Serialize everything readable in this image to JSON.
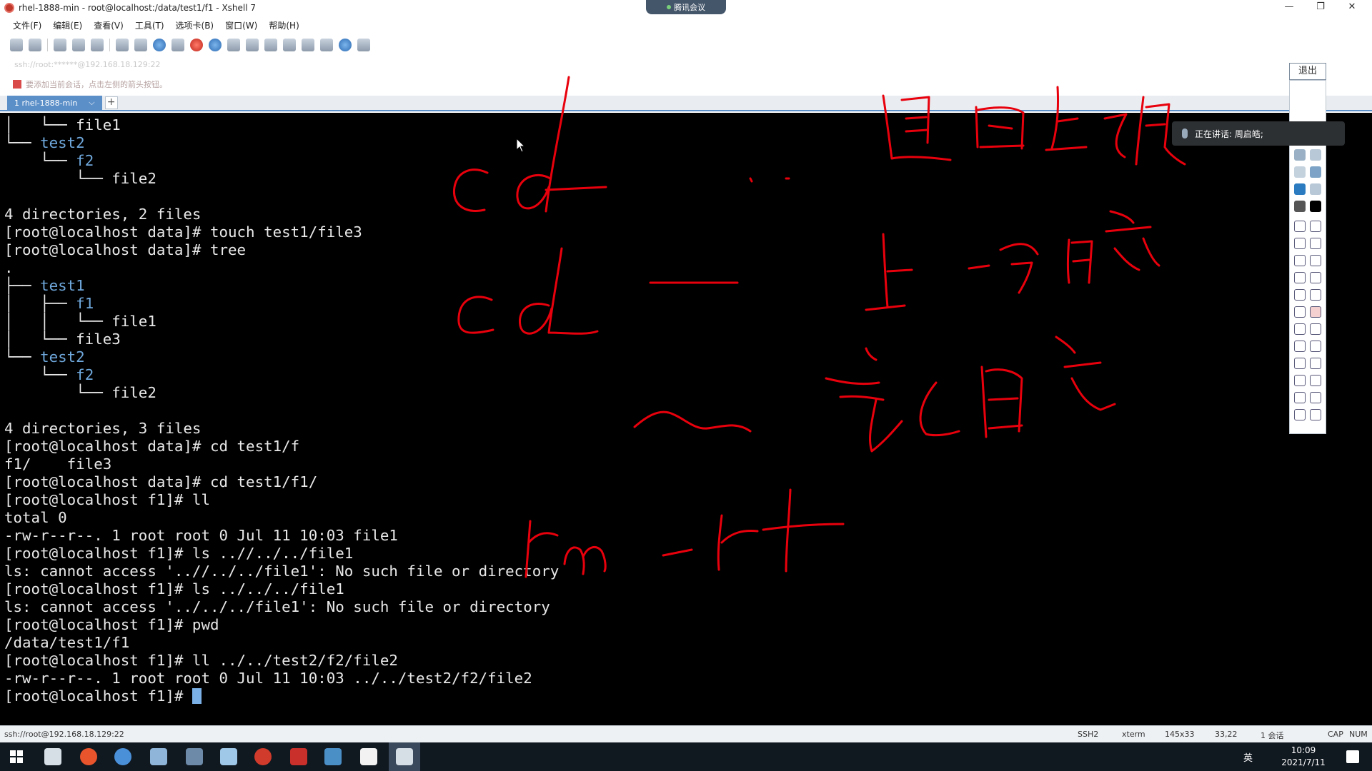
{
  "window": {
    "title": "rhel-1888-min - root@localhost:/data/test1/f1 - Xshell 7",
    "meeting_badge": "腾讯会议",
    "minimize": "—",
    "maximize": "❐",
    "close": "✕"
  },
  "menu": {
    "items": [
      "文件(F)",
      "编辑(E)",
      "查看(V)",
      "工具(T)",
      "选项卡(B)",
      "窗口(W)",
      "帮助(H)"
    ]
  },
  "address_bar": {
    "text": "ssh://root:******@192.168.18.129:22"
  },
  "hint_bar": {
    "text": "要添加当前会话，点击左侧的箭头按钮。"
  },
  "tabs": {
    "active_label": "1 rhel-1888-min",
    "add_label": "+"
  },
  "terminal": {
    "lines": [
      "│   └── file1",
      "└── test2",
      "    └── f2",
      "        └── file2",
      "",
      "4 directories, 2 files",
      "[root@localhost data]# touch test1/file3",
      "[root@localhost data]# tree",
      ".",
      "├── test1",
      "│   ├── f1",
      "│   │   └── file1",
      "│   └── file3",
      "└── test2",
      "    └── f2",
      "        └── file2",
      "",
      "4 directories, 3 files",
      "[root@localhost data]# cd test1/f",
      "f1/    file3",
      "[root@localhost data]# cd test1/f1/",
      "[root@localhost f1]# ll",
      "total 0",
      "-rw-r--r--. 1 root root 0 Jul 11 10:03 file1",
      "[root@localhost f1]# ls ..//../../file1",
      "ls: cannot access '..//../../file1': No such file or directory",
      "[root@localhost f1]# ls ../../../file1",
      "ls: cannot access '../../../file1': No such file or directory",
      "[root@localhost f1]# pwd",
      "/data/test1/f1",
      "[root@localhost f1]# ll ../../test2/f2/file2",
      "-rw-r--r--. 1 root root 0 Jul 11 10:03 ../../test2/f2/file2",
      "[root@localhost f1]# "
    ],
    "dir_names": [
      "test1",
      "test2",
      "f1",
      "f2"
    ]
  },
  "meeting_panel": {
    "exit_label": "退出",
    "speaking_label": "正在讲话: 周启皓;"
  },
  "status_bar": {
    "connection": "ssh://root@192.168.18.129:22",
    "protocol": "SSH2",
    "term": "xterm",
    "size": "145x33",
    "cursor_pos": "33,22",
    "sessions": "1 会话",
    "caps": "CAP",
    "num": "NUM"
  },
  "taskbar": {
    "time": "10:09",
    "date": "2021/7/11",
    "ime": "英"
  },
  "colors": {
    "ink": "#e8000c",
    "terminal_bg": "#000000",
    "directory": "#6fa8dc",
    "tab_accent": "#5b8fc8"
  }
}
